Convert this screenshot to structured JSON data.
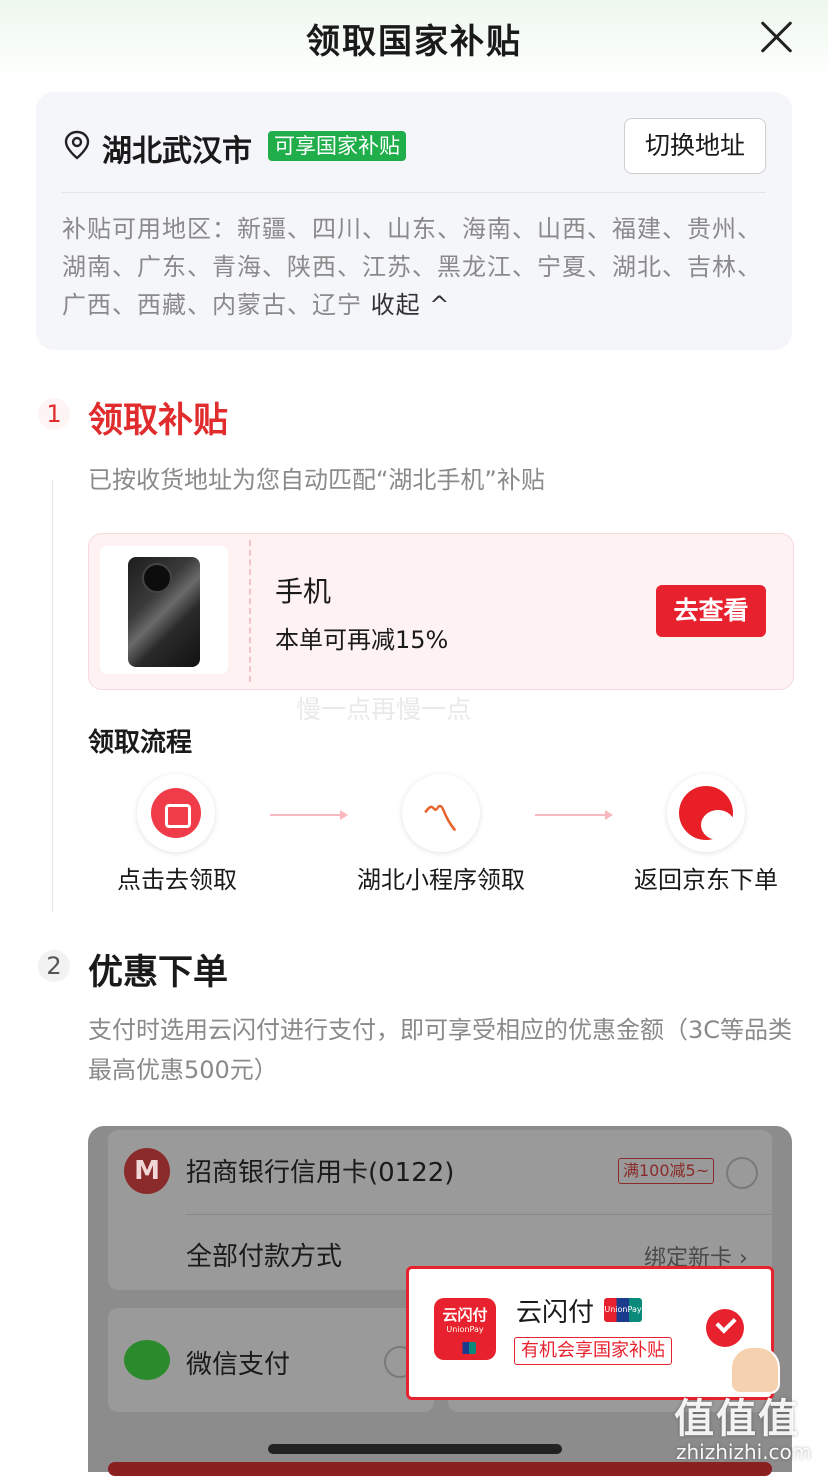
{
  "header": {
    "title": "领取国家补贴"
  },
  "address": {
    "city": "湖北武汉市",
    "badge": "可享国家补贴",
    "switch_label": "切换地址",
    "regions_text": "补贴可用地区：新疆、四川、山东、海南、山西、福建、贵州、湖南、广东、青海、陕西、江苏、黑龙江、宁夏、湖北、吉林、广西、西藏、内蒙古、辽宁",
    "collapse_label": "收起 ^"
  },
  "step1": {
    "number": "1",
    "title": "领取补贴",
    "desc": "已按收货地址为您自动匹配“湖北手机”补贴",
    "product": {
      "name": "手机",
      "discount": "本单可再减15%",
      "button": "去查看"
    },
    "watermark": "慢一点再慢一点",
    "flow_title": "领取流程",
    "flow": [
      {
        "label": "点击去领取",
        "icon": "ticket-icon"
      },
      {
        "label": "湖北小程序领取",
        "icon": "hubei-logo-icon"
      },
      {
        "label": "返回京东下单",
        "icon": "jd-mascot-icon"
      }
    ]
  },
  "step2": {
    "number": "2",
    "title": "优惠下单",
    "desc": "支付时选用云闪付进行支付，即可享受相应的优惠金额（3C等品类最高优惠500元）"
  },
  "payment": {
    "cmb_name": "招商银行信用卡(0122)",
    "cmb_promo": "满100减5~",
    "all_methods": "全部付款方式",
    "bind_card": "绑定新卡 ›",
    "wechat": "微信支付",
    "unionpay_name": "云闪付",
    "unionpay_logo": "云闪付",
    "unionpay_logo_sub": "UnionPay",
    "unionpay_mini": "UnionPay 银联",
    "unionpay_tag": "有机会享国家补贴"
  },
  "site_watermark": {
    "logo": "值值值",
    "url": "zhizhizhi.com"
  },
  "colors": {
    "accent_red": "#e8212e",
    "green_badge": "#1fae4a"
  }
}
